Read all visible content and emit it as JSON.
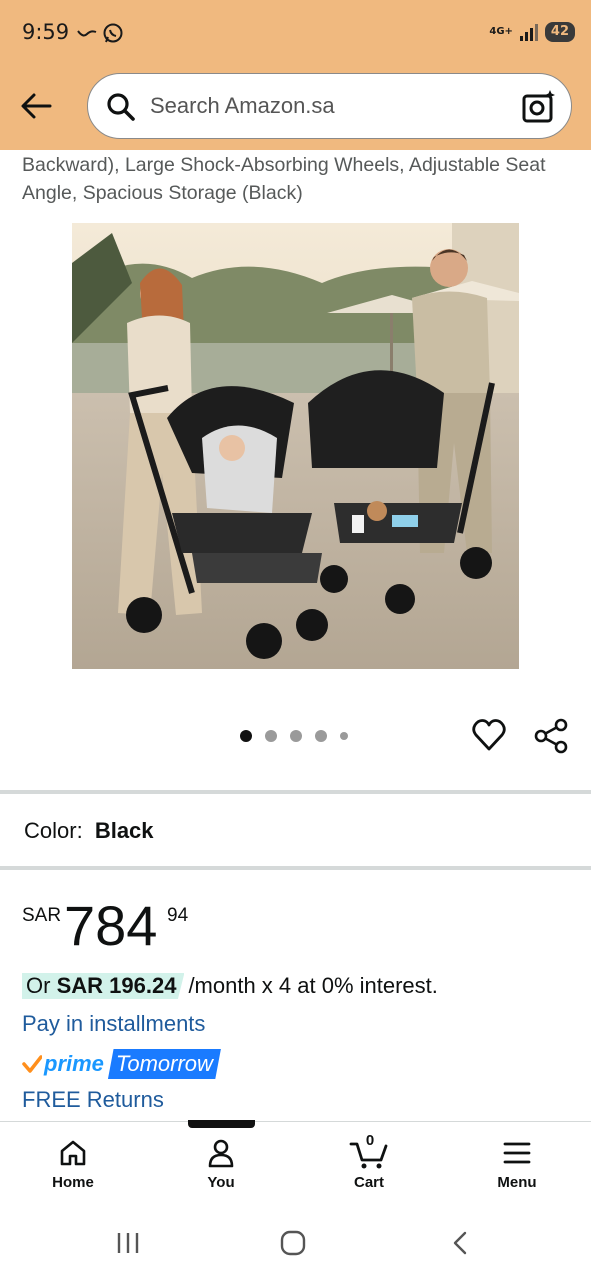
{
  "status_bar": {
    "time": "9:59",
    "network": "4G+",
    "battery": "42"
  },
  "search": {
    "placeholder": "Search Amazon.sa"
  },
  "product": {
    "title_fragment": "Backward), Large Shock-Absorbing Wheels, Adjustable Seat Angle, Spacious Storage (Black)",
    "image_count": 5,
    "active_image": 1,
    "color_label": "Color:",
    "color_value": "Black"
  },
  "price": {
    "currency": "SAR",
    "whole": "784",
    "fraction": "94"
  },
  "installment": {
    "prefix": "Or",
    "amount": "SAR 196.24",
    "suffix": "/month x 4 at 0% interest.",
    "link": "Pay in installments"
  },
  "delivery": {
    "prime_label": "prime",
    "day": "Tomorrow",
    "returns": "FREE Returns"
  },
  "bottom_nav": {
    "home": "Home",
    "you": "You",
    "cart": "Cart",
    "cart_count": "0",
    "menu": "Menu"
  },
  "colors": {
    "header_bg": "#f0b97f",
    "link": "#1f5b9c",
    "prime_blue": "#1a98ff",
    "installment_bg": "#d2f2ea"
  }
}
